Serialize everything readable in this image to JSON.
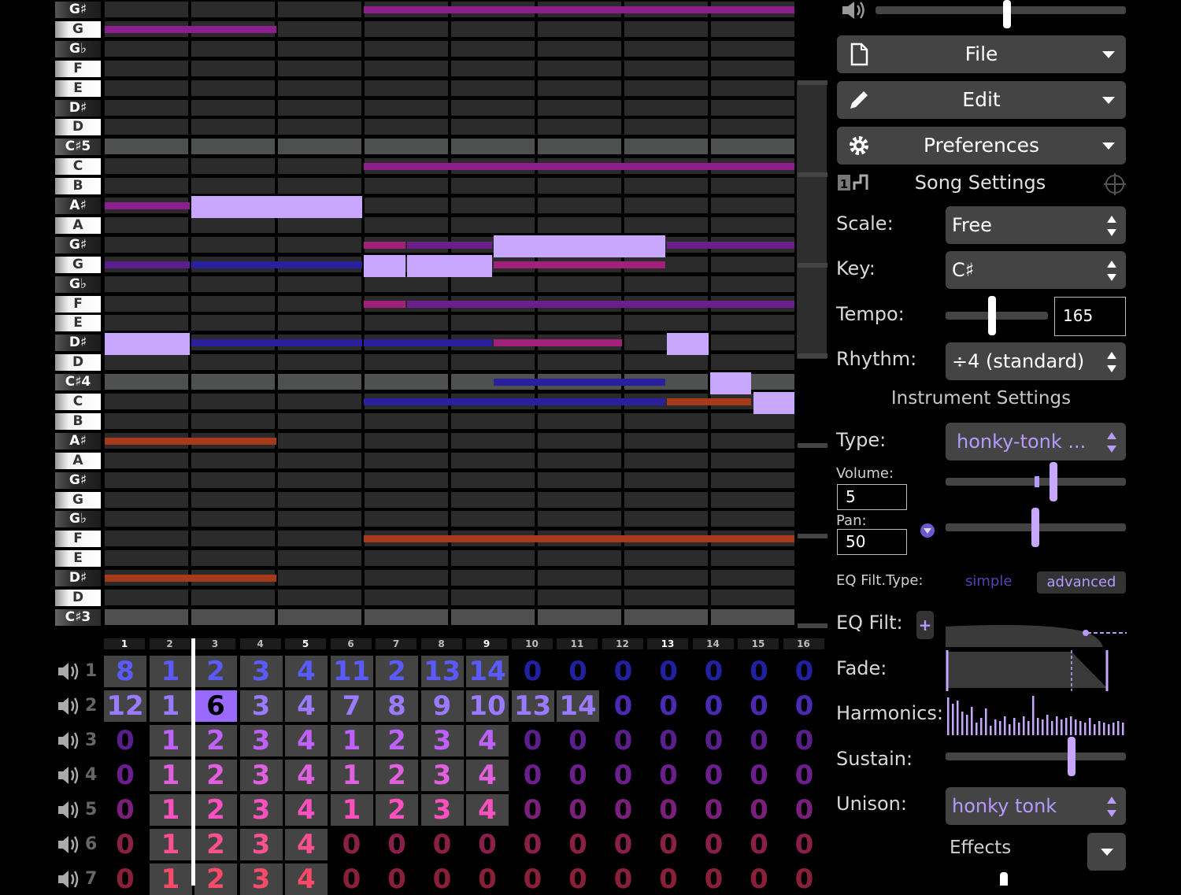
{
  "piano_keys": [
    {
      "label": "G♯",
      "type": "b"
    },
    {
      "label": "G",
      "type": "w"
    },
    {
      "label": "G♭",
      "type": "b"
    },
    {
      "label": "F",
      "type": "w"
    },
    {
      "label": "E",
      "type": "w"
    },
    {
      "label": "D♯",
      "type": "b"
    },
    {
      "label": "D",
      "type": "w"
    },
    {
      "label": "C♯5",
      "type": "c"
    },
    {
      "label": "C",
      "type": "w"
    },
    {
      "label": "B",
      "type": "w"
    },
    {
      "label": "A♯",
      "type": "b"
    },
    {
      "label": "A",
      "type": "w"
    },
    {
      "label": "G♯",
      "type": "b"
    },
    {
      "label": "G",
      "type": "w"
    },
    {
      "label": "G♭",
      "type": "b"
    },
    {
      "label": "F",
      "type": "w"
    },
    {
      "label": "E",
      "type": "w"
    },
    {
      "label": "D♯",
      "type": "b"
    },
    {
      "label": "D",
      "type": "w"
    },
    {
      "label": "C♯4",
      "type": "c"
    },
    {
      "label": "C",
      "type": "w"
    },
    {
      "label": "B",
      "type": "w"
    },
    {
      "label": "A♯",
      "type": "b"
    },
    {
      "label": "A",
      "type": "w"
    },
    {
      "label": "G♯",
      "type": "b"
    },
    {
      "label": "G",
      "type": "w"
    },
    {
      "label": "G♭",
      "type": "b"
    },
    {
      "label": "F",
      "type": "w"
    },
    {
      "label": "E",
      "type": "w"
    },
    {
      "label": "D♯",
      "type": "b"
    },
    {
      "label": "D",
      "type": "w"
    },
    {
      "label": "C♯3",
      "type": "c"
    }
  ],
  "notes": [
    {
      "row": 0,
      "start": 6,
      "end": 16,
      "color": "#8c1f8c",
      "thick": false
    },
    {
      "row": 1,
      "start": 0,
      "end": 4,
      "color": "#8c1f8c",
      "thick": false
    },
    {
      "row": 8,
      "start": 6,
      "end": 16,
      "color": "#8c1f8c",
      "thick": false
    },
    {
      "row": 10,
      "start": 0,
      "end": 2,
      "color": "#8c1f8c",
      "thick": false
    },
    {
      "row": 10,
      "start": 2,
      "end": 6,
      "color": "#c7a7ff",
      "thick": true
    },
    {
      "row": 12,
      "start": 6,
      "end": 7,
      "color": "#a0207a",
      "thick": false
    },
    {
      "row": 12,
      "start": 7,
      "end": 9,
      "color": "#6b1f8c",
      "thick": false
    },
    {
      "row": 12,
      "start": 9,
      "end": 13,
      "color": "#c7a7ff",
      "thick": true
    },
    {
      "row": 12,
      "start": 13,
      "end": 16,
      "color": "#6b1f8c",
      "thick": false
    },
    {
      "row": 13,
      "start": 0,
      "end": 2,
      "color": "#5a1f8c",
      "thick": false
    },
    {
      "row": 13,
      "start": 2,
      "end": 6,
      "color": "#2a1f9c",
      "thick": false
    },
    {
      "row": 13,
      "start": 6,
      "end": 7,
      "color": "#c7a7ff",
      "thick": true
    },
    {
      "row": 13,
      "start": 7,
      "end": 9,
      "color": "#c7a7ff",
      "thick": true
    },
    {
      "row": 13,
      "start": 9,
      "end": 13,
      "color": "#a0207a",
      "thick": false
    },
    {
      "row": 15,
      "start": 6,
      "end": 7,
      "color": "#a0207a",
      "thick": false
    },
    {
      "row": 15,
      "start": 7,
      "end": 16,
      "color": "#6b1f8c",
      "thick": false
    },
    {
      "row": 17,
      "start": 0,
      "end": 2,
      "color": "#c7a7ff",
      "thick": true
    },
    {
      "row": 17,
      "start": 2,
      "end": 6,
      "color": "#2a1f9c",
      "thick": false
    },
    {
      "row": 17,
      "start": 6,
      "end": 9,
      "color": "#2a1f9c",
      "thick": false
    },
    {
      "row": 17,
      "start": 9,
      "end": 12,
      "color": "#a0207a",
      "thick": false
    },
    {
      "row": 17,
      "start": 13,
      "end": 14,
      "color": "#c7a7ff",
      "thick": true
    },
    {
      "row": 19,
      "start": 9,
      "end": 13,
      "color": "#2a1f9c",
      "thick": false
    },
    {
      "row": 19,
      "start": 14,
      "end": 15,
      "color": "#c7a7ff",
      "thick": true
    },
    {
      "row": 20,
      "start": 6,
      "end": 13,
      "color": "#2a1f9c",
      "thick": false
    },
    {
      "row": 20,
      "start": 13,
      "end": 15,
      "color": "#a83a1c",
      "thick": false
    },
    {
      "row": 20,
      "start": 15,
      "end": 16,
      "color": "#c7a7ff",
      "thick": true
    },
    {
      "row": 22,
      "start": 0,
      "end": 4,
      "color": "#a83a1c",
      "thick": false
    },
    {
      "row": 27,
      "start": 6,
      "end": 16,
      "color": "#a83a1c",
      "thick": false
    },
    {
      "row": 29,
      "start": 0,
      "end": 4,
      "color": "#a83a1c",
      "thick": false
    }
  ],
  "bar_numbers": [
    "1",
    "2",
    "3",
    "4",
    "5",
    "6",
    "7",
    "8",
    "9",
    "10",
    "11",
    "12",
    "13",
    "14",
    "15",
    "16"
  ],
  "highlighted_bars": [
    1,
    5,
    9,
    13
  ],
  "channels": [
    {
      "num": "1",
      "color": "#5a5aff",
      "dim": "#2020a0",
      "values": [
        "8",
        "1",
        "2",
        "3",
        "4",
        "11",
        "2",
        "13",
        "14",
        "0",
        "0",
        "0",
        "0",
        "0",
        "0",
        "0"
      ]
    },
    {
      "num": "2",
      "color": "#9a7aff",
      "dim": "#4a2ab0",
      "values": [
        "12",
        "1",
        "6",
        "3",
        "4",
        "7",
        "8",
        "9",
        "10",
        "13",
        "14",
        "0",
        "0",
        "0",
        "0",
        "0"
      ]
    },
    {
      "num": "3",
      "color": "#c060ff",
      "dim": "#5a1f8c",
      "values": [
        "0",
        "1",
        "2",
        "3",
        "4",
        "1",
        "2",
        "3",
        "4",
        "0",
        "0",
        "0",
        "0",
        "0",
        "0",
        "0"
      ]
    },
    {
      "num": "4",
      "color": "#e060e0",
      "dim": "#6a1f8c",
      "values": [
        "0",
        "1",
        "2",
        "3",
        "4",
        "1",
        "2",
        "3",
        "4",
        "0",
        "0",
        "0",
        "0",
        "0",
        "0",
        "0"
      ]
    },
    {
      "num": "5",
      "color": "#ff50c0",
      "dim": "#7a1f7a",
      "values": [
        "0",
        "1",
        "2",
        "3",
        "4",
        "1",
        "2",
        "3",
        "4",
        "0",
        "0",
        "0",
        "0",
        "0",
        "0",
        "0"
      ]
    },
    {
      "num": "6",
      "color": "#ff5090",
      "dim": "#8a1f4a",
      "values": [
        "0",
        "1",
        "2",
        "3",
        "4",
        "0",
        "0",
        "0",
        "0",
        "0",
        "0",
        "0",
        "0",
        "0",
        "0",
        "0"
      ]
    },
    {
      "num": "7",
      "color": "#ff4a6a",
      "dim": "#8a1f3a",
      "values": [
        "0",
        "1",
        "2",
        "3",
        "4",
        "0",
        "0",
        "0",
        "0",
        "0",
        "0",
        "0",
        "0",
        "0",
        "0",
        "0"
      ]
    }
  ],
  "panel": {
    "file_label": "File",
    "edit_label": "Edit",
    "preferences_label": "Preferences",
    "song_settings_title": "Song Settings",
    "scale_label": "Scale:",
    "scale_value": "Free",
    "key_label": "Key:",
    "key_value": "C♯",
    "tempo_label": "Tempo:",
    "tempo_value": "165",
    "rhythm_label": "Rhythm:",
    "rhythm_value": "÷4 (standard)",
    "instrument_settings_title": "Instrument Settings",
    "type_label": "Type:",
    "type_value": "honky-tonk ...",
    "volume_label": "Volume:",
    "volume_value": "5",
    "pan_label": "Pan:",
    "pan_value": "50",
    "eq_filt_type_label": "EQ Filt.Type:",
    "eq_simple": "simple",
    "eq_advanced": "advanced",
    "eq_filt_label": "EQ Filt:",
    "fade_label": "Fade:",
    "harmonics_label": "Harmonics:",
    "sustain_label": "Sustain:",
    "unison_label": "Unison:",
    "unison_value": "honky tonk",
    "effects_label": "Effects"
  },
  "colors": {
    "accent": "#c7a7ff",
    "dim_accent": "#6a5acd"
  }
}
